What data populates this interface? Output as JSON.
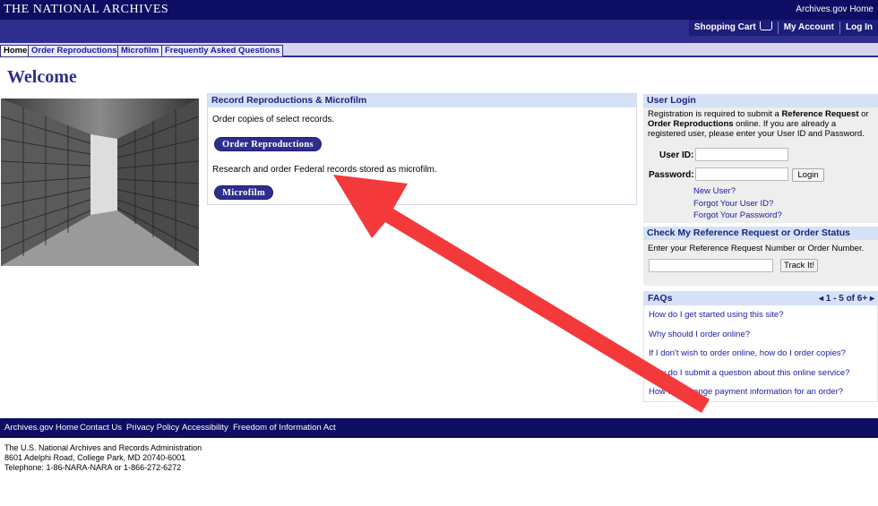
{
  "header": {
    "brand": "THE NATIONAL ARCHIVES",
    "home_link": "Archives.gov Home",
    "shopping_cart": "Shopping Cart",
    "my_account": "My Account",
    "log_in": "Log In"
  },
  "tabs": [
    {
      "label": "Home",
      "active": true
    },
    {
      "label": "Order Reproductions",
      "active": false
    },
    {
      "label": "Microfilm",
      "active": false
    },
    {
      "label": "Frequently Asked Questions",
      "active": false
    }
  ],
  "welcome": "Welcome",
  "record_panel": {
    "title": "Record Reproductions & Microfilm",
    "order_text": "Order copies of select records.",
    "order_button": "Order Reproductions",
    "microfilm_text": "Research and order Federal records stored as microfilm.",
    "microfilm_button": "Microfilm"
  },
  "login": {
    "title": "User Login",
    "desc_1": "Registration is required to submit a ",
    "desc_bold_1": "Reference Request",
    "desc_2": " or ",
    "desc_bold_2": "Order Reproductions",
    "desc_3": " online. If you are already a registered user, please enter your User ID and Password.",
    "user_id_label": "User ID:",
    "password_label": "Password:",
    "login_button": "Login",
    "new_user": "New User?",
    "forgot_id": "Forgot Your User ID?",
    "forgot_password": "Forgot Your Password?"
  },
  "status": {
    "title": "Check My Reference Request or Order Status",
    "desc": "Enter your Reference Request Number or Order Number.",
    "track_button": "Track It!"
  },
  "faqs": {
    "title": "FAQs",
    "pager": "1 - 5 of 6+",
    "items": [
      "How do I get started using this site?",
      "Why should I order online?",
      "If I don't wish to order online, how do I order copies?",
      "How do I submit a question about this online service?",
      "How do I change payment information for an order?"
    ]
  },
  "footer": {
    "links": [
      "Archives.gov Home",
      "Contact Us",
      "Privacy Policy",
      "Accessibility",
      "Freedom of Information Act"
    ],
    "address_1": "The U.S. National Archives and Records Administration",
    "address_2": "8601 Adelphi Road, College Park, MD 20740-6001",
    "address_3": "Telephone: 1-86-NARA-NARA or 1-866-272-6272"
  },
  "colors": {
    "navy": "#0d0d63",
    "blue": "#2e2e8f",
    "panel_head": "#d5e2f5",
    "annotation_arrow": "#f4393a"
  }
}
